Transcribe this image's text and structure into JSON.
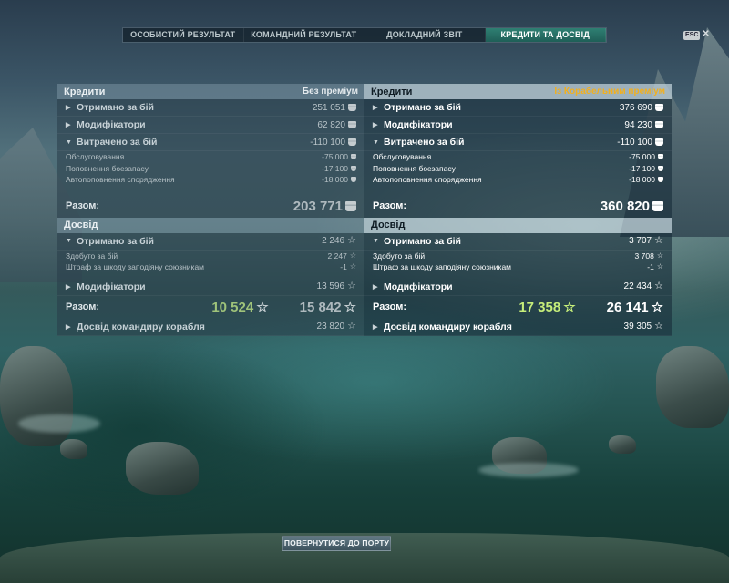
{
  "tabs": [
    {
      "label": "ОСОБИСТИЙ РЕЗУЛЬТАТ"
    },
    {
      "label": "КОМАНДНИЙ РЕЗУЛЬТАТ"
    },
    {
      "label": "ДОКЛАДНИЙ ЗВІТ"
    },
    {
      "label": "КРЕДИТИ ТА ДОСВІД",
      "active": true
    }
  ],
  "esc": {
    "key": "ESC",
    "close": "✕"
  },
  "left": {
    "credits": {
      "title": "Кредити",
      "hint": "Без преміум",
      "earned": {
        "label": "Отримано за бій",
        "value": "251 051"
      },
      "modifiers": {
        "label": "Модифікатори",
        "value": "62 820"
      },
      "spent": {
        "label": "Витрачено за бій",
        "value": "-110 100"
      },
      "spent_items": [
        {
          "label": "Обслуговування",
          "value": "-75 000"
        },
        {
          "label": "Поповнення боєзапасу",
          "value": "-17 100"
        },
        {
          "label": "Автопоповнення спорядження",
          "value": "-18 000"
        }
      ],
      "total": {
        "label": "Разом:",
        "value": "203 771"
      }
    },
    "xp": {
      "title": "Досвід",
      "earned": {
        "label": "Отримано за бій",
        "value": "2 246"
      },
      "earned_items": [
        {
          "label": "Здобуто за бій",
          "value": "2 247"
        },
        {
          "label": "Штраф за шкоду заподіяну союзникам",
          "value": "-1"
        }
      ],
      "modifiers": {
        "label": "Модифікатори",
        "value": "13 596"
      },
      "total": {
        "label": "Разом:",
        "free": "10 524",
        "value": "15 842"
      },
      "commander": {
        "label": "Досвід командиру корабля",
        "value": "23 820"
      }
    }
  },
  "right": {
    "credits": {
      "title": "Кредити",
      "hint": "Із Корабельним преміум",
      "earned": {
        "label": "Отримано за бій",
        "value": "376 690"
      },
      "modifiers": {
        "label": "Модифікатори",
        "value": "94 230"
      },
      "spent": {
        "label": "Витрачено за бій",
        "value": "-110 100"
      },
      "spent_items": [
        {
          "label": "Обслуговування",
          "value": "-75 000"
        },
        {
          "label": "Поповнення боєзапасу",
          "value": "-17 100"
        },
        {
          "label": "Автопоповнення спорядження",
          "value": "-18 000"
        }
      ],
      "total": {
        "label": "Разом:",
        "value": "360 820"
      }
    },
    "xp": {
      "title": "Досвід",
      "earned": {
        "label": "Отримано за бій",
        "value": "3 707"
      },
      "earned_items": [
        {
          "label": "Здобуто за бій",
          "value": "3 708"
        },
        {
          "label": "Штраф за шкоду заподіяну союзникам",
          "value": "-1"
        }
      ],
      "modifiers": {
        "label": "Модифікатори",
        "value": "22 434"
      },
      "total": {
        "label": "Разом:",
        "free": "17 358",
        "value": "26 141"
      },
      "commander": {
        "label": "Досвід командиру корабля",
        "value": "39 305"
      }
    }
  },
  "footer": {
    "return_button": "ПОВЕРНУТИСЯ ДО ПОРТУ"
  },
  "colors": {
    "premium_hint": "#f2b01e",
    "free_xp_left": "#9fc37a",
    "free_xp_right": "#c6ee7a",
    "active_tab": "#2f7f73"
  },
  "icons": {
    "credit": "credit-coin-icon",
    "xp": "star-icon",
    "expand": "triangle-right-icon",
    "collapse": "triangle-down-icon"
  }
}
